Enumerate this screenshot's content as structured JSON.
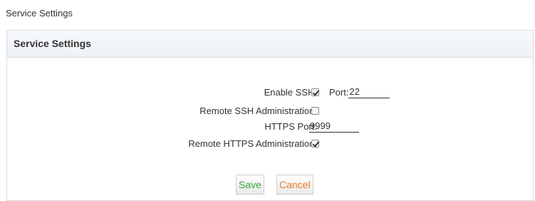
{
  "page": {
    "title": "Service Settings"
  },
  "panel": {
    "header": "Service Settings"
  },
  "form": {
    "enable_ssh": {
      "label": "Enable SSH:",
      "checked": true,
      "port_label": "Port:",
      "port_value": "22"
    },
    "remote_ssh": {
      "label": "Remote SSH Administration:",
      "checked": false
    },
    "https_port": {
      "label": "HTTPS Port:",
      "value": "9999"
    },
    "remote_https": {
      "label": "Remote HTTPS Administration:",
      "checked": true
    }
  },
  "buttons": {
    "save": "Save",
    "cancel": "Cancel"
  },
  "colors": {
    "save": "#3aa63a",
    "cancel": "#ee7a2a",
    "header_bg": "#f1f4f8",
    "border": "#d5dbe3"
  }
}
